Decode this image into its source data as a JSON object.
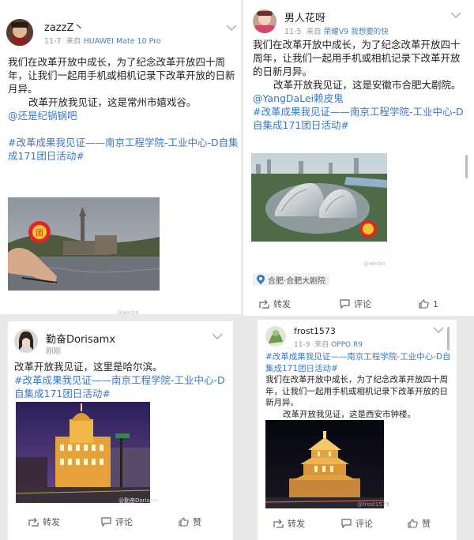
{
  "posts": [
    {
      "user": "zazzZ丶",
      "date": "11-7",
      "from_label": "来自",
      "device": "HUAWEI Mate 10 Pro",
      "paragraph1": "我们在改革开放中成长，为了纪念改革开放四十周年，让我们一起用手机或相机记录下改革开放的日新月异。",
      "paragraph2": "改革开放我见证，这是常州市嬉戏谷。",
      "mention": "@还是纪锅锅吧",
      "hashtag": "#改革成果我见证——南京工程学院-工业中心-D自集成171团日活动#"
    },
    {
      "user": "男人花呀",
      "date": "11-5",
      "from_label": "来自",
      "device": "荣耀V9 我想要的快",
      "paragraph1": "我们在改革开放中成长，为了纪念改革开放四十周年，让我们一起用手机或相机记录下改革开放的日新月异。",
      "paragraph2": "改革开放我见证，这是安徽市合肥大剧院。",
      "mention": "@YangDaLei赖皮鬼",
      "hashtag": "#改革成果我见证——南京工程学院-工业中心-D自集成171团日活动#",
      "location": "合肥·合肥大剧院",
      "actions": {
        "repost": "转发",
        "comment": "评论",
        "like": "1"
      }
    },
    {
      "user": "勤奋Dorisamx",
      "date": "刚刚",
      "paragraph1": "改革开放我见证，这里是哈尔滨。",
      "hashtag": "#改革成果我见证——南京工程学院-工业中心-D自集成171团日活动#",
      "watermark": "@勤奋Dorisam",
      "actions": {
        "repost": "转发",
        "comment": "评论",
        "like": "赞"
      }
    },
    {
      "user": "frost1573",
      "date": "11-9",
      "from_label": "来自",
      "device": "OPPO R9",
      "hashtag": "#改革成果我见证——南京工程学院-工业中心-D自集成171团日活动#",
      "paragraph1": "我们在改革开放中成长，为了纪念改革开放四十周年，让我们一起用手机或相机记录下改革开放的日新月异。",
      "paragraph2": "改革开放我见证，这是西安市钟楼。",
      "watermark": "@frost1573",
      "actions": {
        "repost": "转发",
        "comment": "评论",
        "like": "赞"
      }
    }
  ],
  "colors": {
    "link": "#3a78c3",
    "device": "#4a7fb5",
    "background": "#e9e9e9"
  }
}
